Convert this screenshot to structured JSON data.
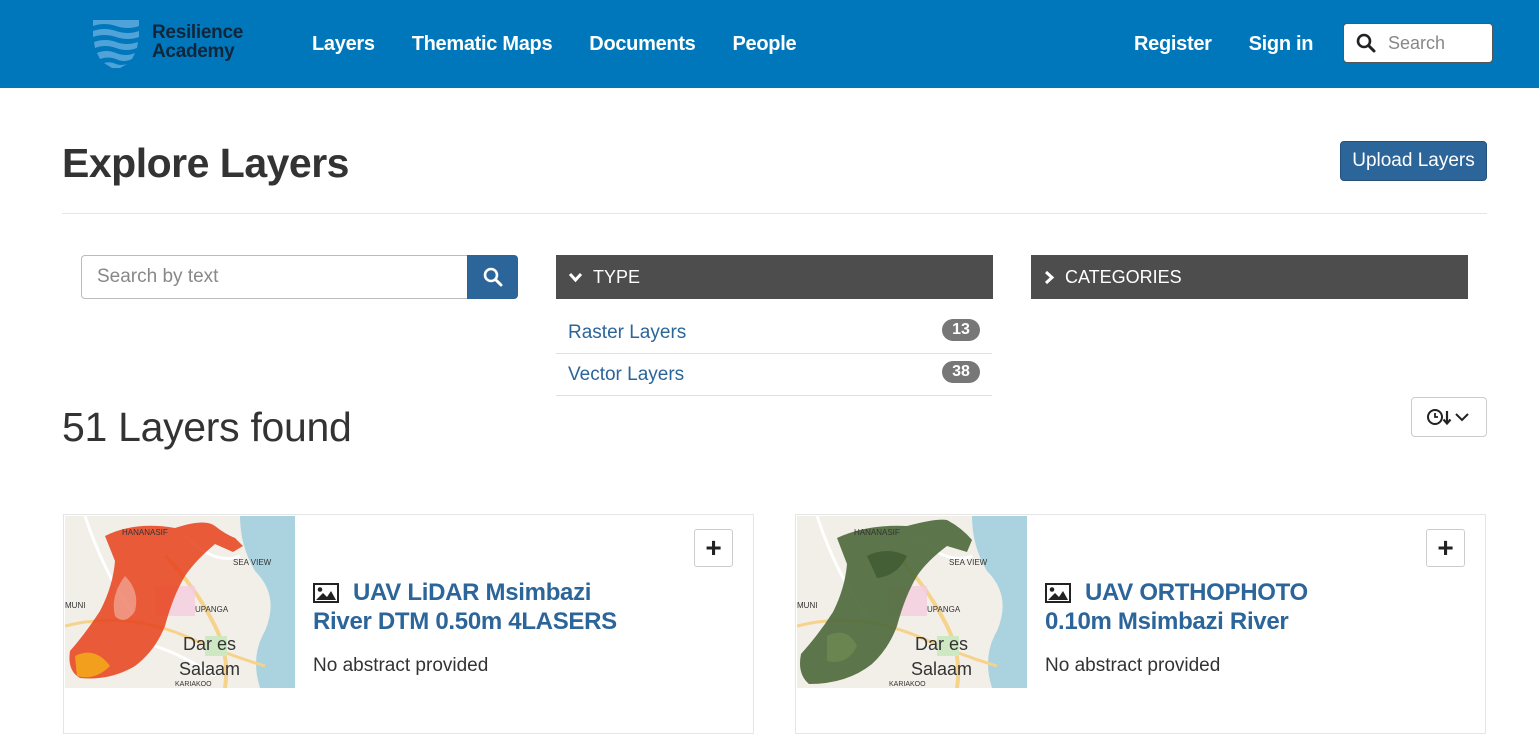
{
  "brand": {
    "line1": "Resilience",
    "line2": "Academy"
  },
  "nav": {
    "left": [
      "Layers",
      "Thematic Maps",
      "Documents",
      "People"
    ],
    "register": "Register",
    "signin": "Sign in",
    "search_placeholder": "Search"
  },
  "page": {
    "title": "Explore Layers",
    "upload_label": "Upload Layers",
    "text_search_placeholder": "Search by text",
    "found_label": "51 Layers found"
  },
  "facets": {
    "type_label": "TYPE",
    "categories_label": "CATEGORIES",
    "type_items": [
      {
        "label": "Raster Layers",
        "count": "13"
      },
      {
        "label": "Vector Layers",
        "count": "38"
      }
    ]
  },
  "map_labels": {
    "hananasif": "HANANASIF",
    "sea_view": "SEA VIEW",
    "muni": "MUNI",
    "upanga": "UPANGA",
    "dar": "Dar es",
    "salaam": "Salaam",
    "kariakoo": "KARIAKOO"
  },
  "cards": [
    {
      "title": "UAV LiDAR Msimbazi River DTM 0.50m 4LASERS",
      "abstract": "No abstract provided",
      "add_label": "+"
    },
    {
      "title": "UAV ORTHOPHOTO 0.10m Msimbazi River",
      "abstract": "No abstract provided",
      "add_label": "+"
    }
  ],
  "colors": {
    "header": "#0077bb",
    "accent": "#2c6599",
    "facet": "#4d4d4d",
    "badge": "#777777"
  },
  "icons": [
    "wave-shield-icon",
    "search-icon",
    "chevron-down-icon",
    "chevron-right-icon",
    "clock-sort-icon",
    "image-icon",
    "plus-icon"
  ]
}
